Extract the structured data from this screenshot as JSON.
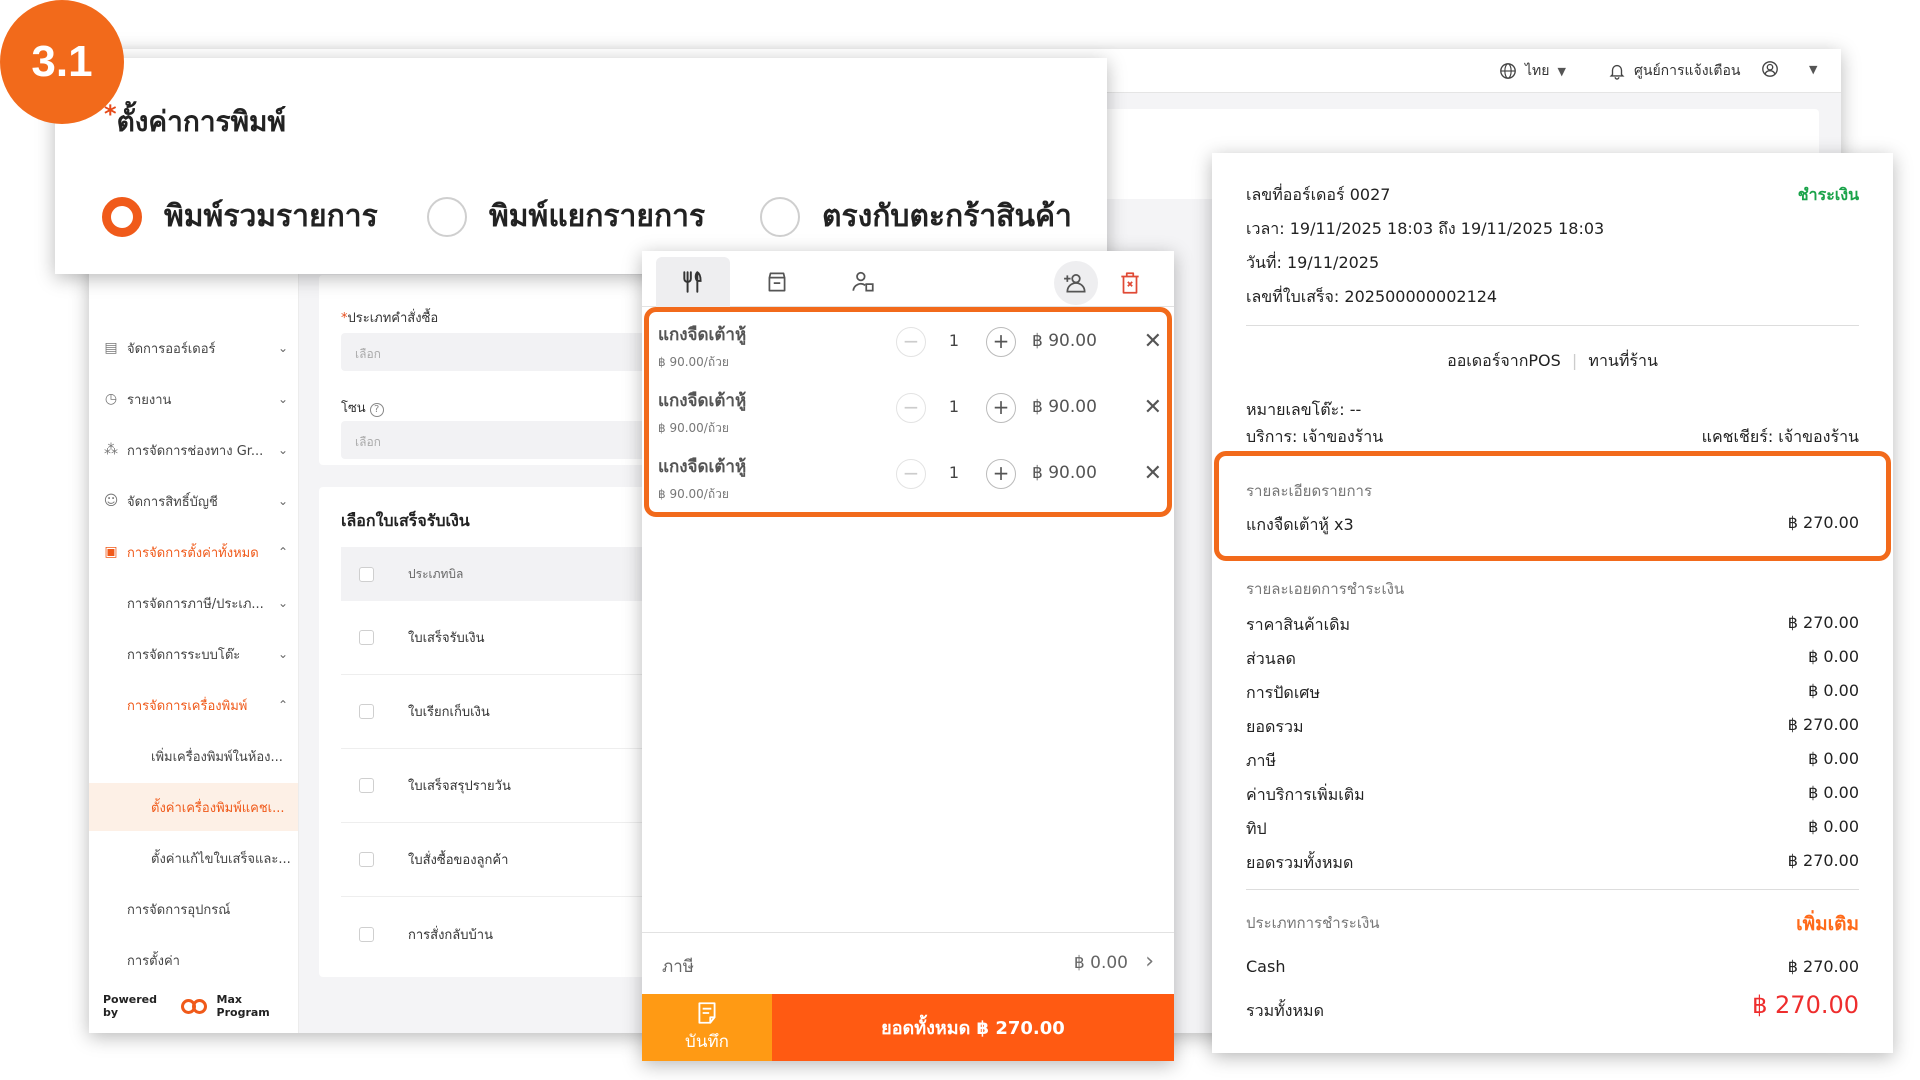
{
  "step_badge": "3.1",
  "admin": {
    "topbar": {
      "language": "ไทย",
      "notifications": "ศูนย์การแจ้งเตือน"
    },
    "sidebar": {
      "items": [
        {
          "label": "จัดการออร์เดอร์",
          "icon": "clipboard-icon"
        },
        {
          "label": "รายงาน",
          "icon": "clock-icon"
        },
        {
          "label": "การจัดการช่องทาง Gr...",
          "icon": "channels-icon"
        },
        {
          "label": "จัดการสิทธิ์บัญชี",
          "icon": "user-rights-icon"
        },
        {
          "label": "การจัดการตั้งค่าทั้งหมด",
          "icon": "settings-icon"
        },
        {
          "label": "การจัดการภาษี/ประเภ..."
        },
        {
          "label": "การจัดการระบบโต๊ะ"
        },
        {
          "label": "การจัดการเครื่องพิมพ์"
        },
        {
          "label": "เพิ่มเครื่องพิมพ์ในห้อง..."
        },
        {
          "label": "ตั้งค่าเครื่องพิมพ์แคชเ..."
        },
        {
          "label": "ตั้งค่าแก้ไขใบเสร็จและ..."
        },
        {
          "label": "การจัดการอุปกรณ์"
        },
        {
          "label": "การตั้งค่า"
        }
      ],
      "powered_by": "Powered by",
      "brand": "Max Program"
    },
    "form": {
      "order_type_label": "ประเภทคำสั่งซื้อ",
      "order_type_placeholder": "เลือก",
      "zone_label": "โซน",
      "zone_placeholder": "เลือก"
    },
    "receipt_types": {
      "title": "เลือกใบเสร็จรับเงิน",
      "header": "ประเภทบิล",
      "rows": [
        "ใบเสร็จรับเงิน",
        "ใบเรียกเก็บเงิน",
        "ใบเสร็จสรุปรายวัน",
        "ใบสั่งซื้อของลูกค้า",
        "การสั่งกลับบ้าน"
      ]
    }
  },
  "print_settings": {
    "title": "ตั้งค่าการพิมพ์",
    "options": [
      {
        "label": "พิมพ์รวมรายการ",
        "checked": true
      },
      {
        "label": "พิมพ์แยกรายการ",
        "checked": false
      },
      {
        "label": "ตรงกับตะกร้าสินค้า",
        "checked": false
      }
    ]
  },
  "pos": {
    "items": [
      {
        "name": "แกงจืดเต้าหู้",
        "unit_price": "฿ 90.00/ถ้วย",
        "qty": "1",
        "price": "฿ 90.00"
      },
      {
        "name": "แกงจืดเต้าหู้",
        "unit_price": "฿ 90.00/ถ้วย",
        "qty": "1",
        "price": "฿ 90.00"
      },
      {
        "name": "แกงจืดเต้าหู้",
        "unit_price": "฿ 90.00/ถ้วย",
        "qty": "1",
        "price": "฿ 90.00"
      }
    ],
    "tax_label": "ภาษี",
    "tax_value": "฿ 0.00",
    "save_label": "บันทึก",
    "total_label": "ยอดทั้งหมด ฿ 270.00"
  },
  "receipt": {
    "order_no": "เลขที่ออร์เดอร์ 0027",
    "status": "ชำระเงิน",
    "time": "เวลา: 19/11/2025 18:03 ถึง 19/11/2025 18:03",
    "date": "วันที่: 19/11/2025",
    "receipt_no": "เลขที่ใบเสร็จ: 202500000002124",
    "source": "ออเดอร์จากPOS",
    "dine": "ทานที่ร้าน",
    "table_no": "หมายเลขโต๊ะ: --",
    "service": "บริการ: เจ้าของร้าน",
    "cashier": "แคชเชียร์: เจ้าของร้าน",
    "items_title": "รายละเอียดรายการ",
    "item_line": "แกงจืดเต้าหู้ x3",
    "item_amount": "฿ 270.00",
    "payment_detail_title": "รายละเอยดการชำระเงิน",
    "summary": [
      {
        "label": "ราคาสินค้าเดิม",
        "value": "฿ 270.00"
      },
      {
        "label": "ส่วนลด",
        "value": "฿ 0.00"
      },
      {
        "label": "การปัดเศษ",
        "value": "฿ 0.00"
      },
      {
        "label": "ยอดรวม",
        "value": "฿ 270.00"
      },
      {
        "label": "ภาษี",
        "value": "฿ 0.00"
      },
      {
        "label": "ค่าบริการเพิ่มเติม",
        "value": "฿ 0.00"
      },
      {
        "label": "ทิป",
        "value": "฿ 0.00"
      },
      {
        "label": "ยอดรวมทั้งหมด",
        "value": "฿ 270.00"
      }
    ],
    "payment_type_title": "ประเภทการชำระเงิน",
    "add_more": "เพิ่มเติม",
    "cash_label": "Cash",
    "cash_value": "฿ 270.00",
    "grand_label": "รวมทั้งหมด",
    "grand_value": "฿ 270.00"
  },
  "colors": {
    "accent": "#f26a1b",
    "paid": "#1aa34a",
    "grand_total": "#ee2d2d"
  }
}
